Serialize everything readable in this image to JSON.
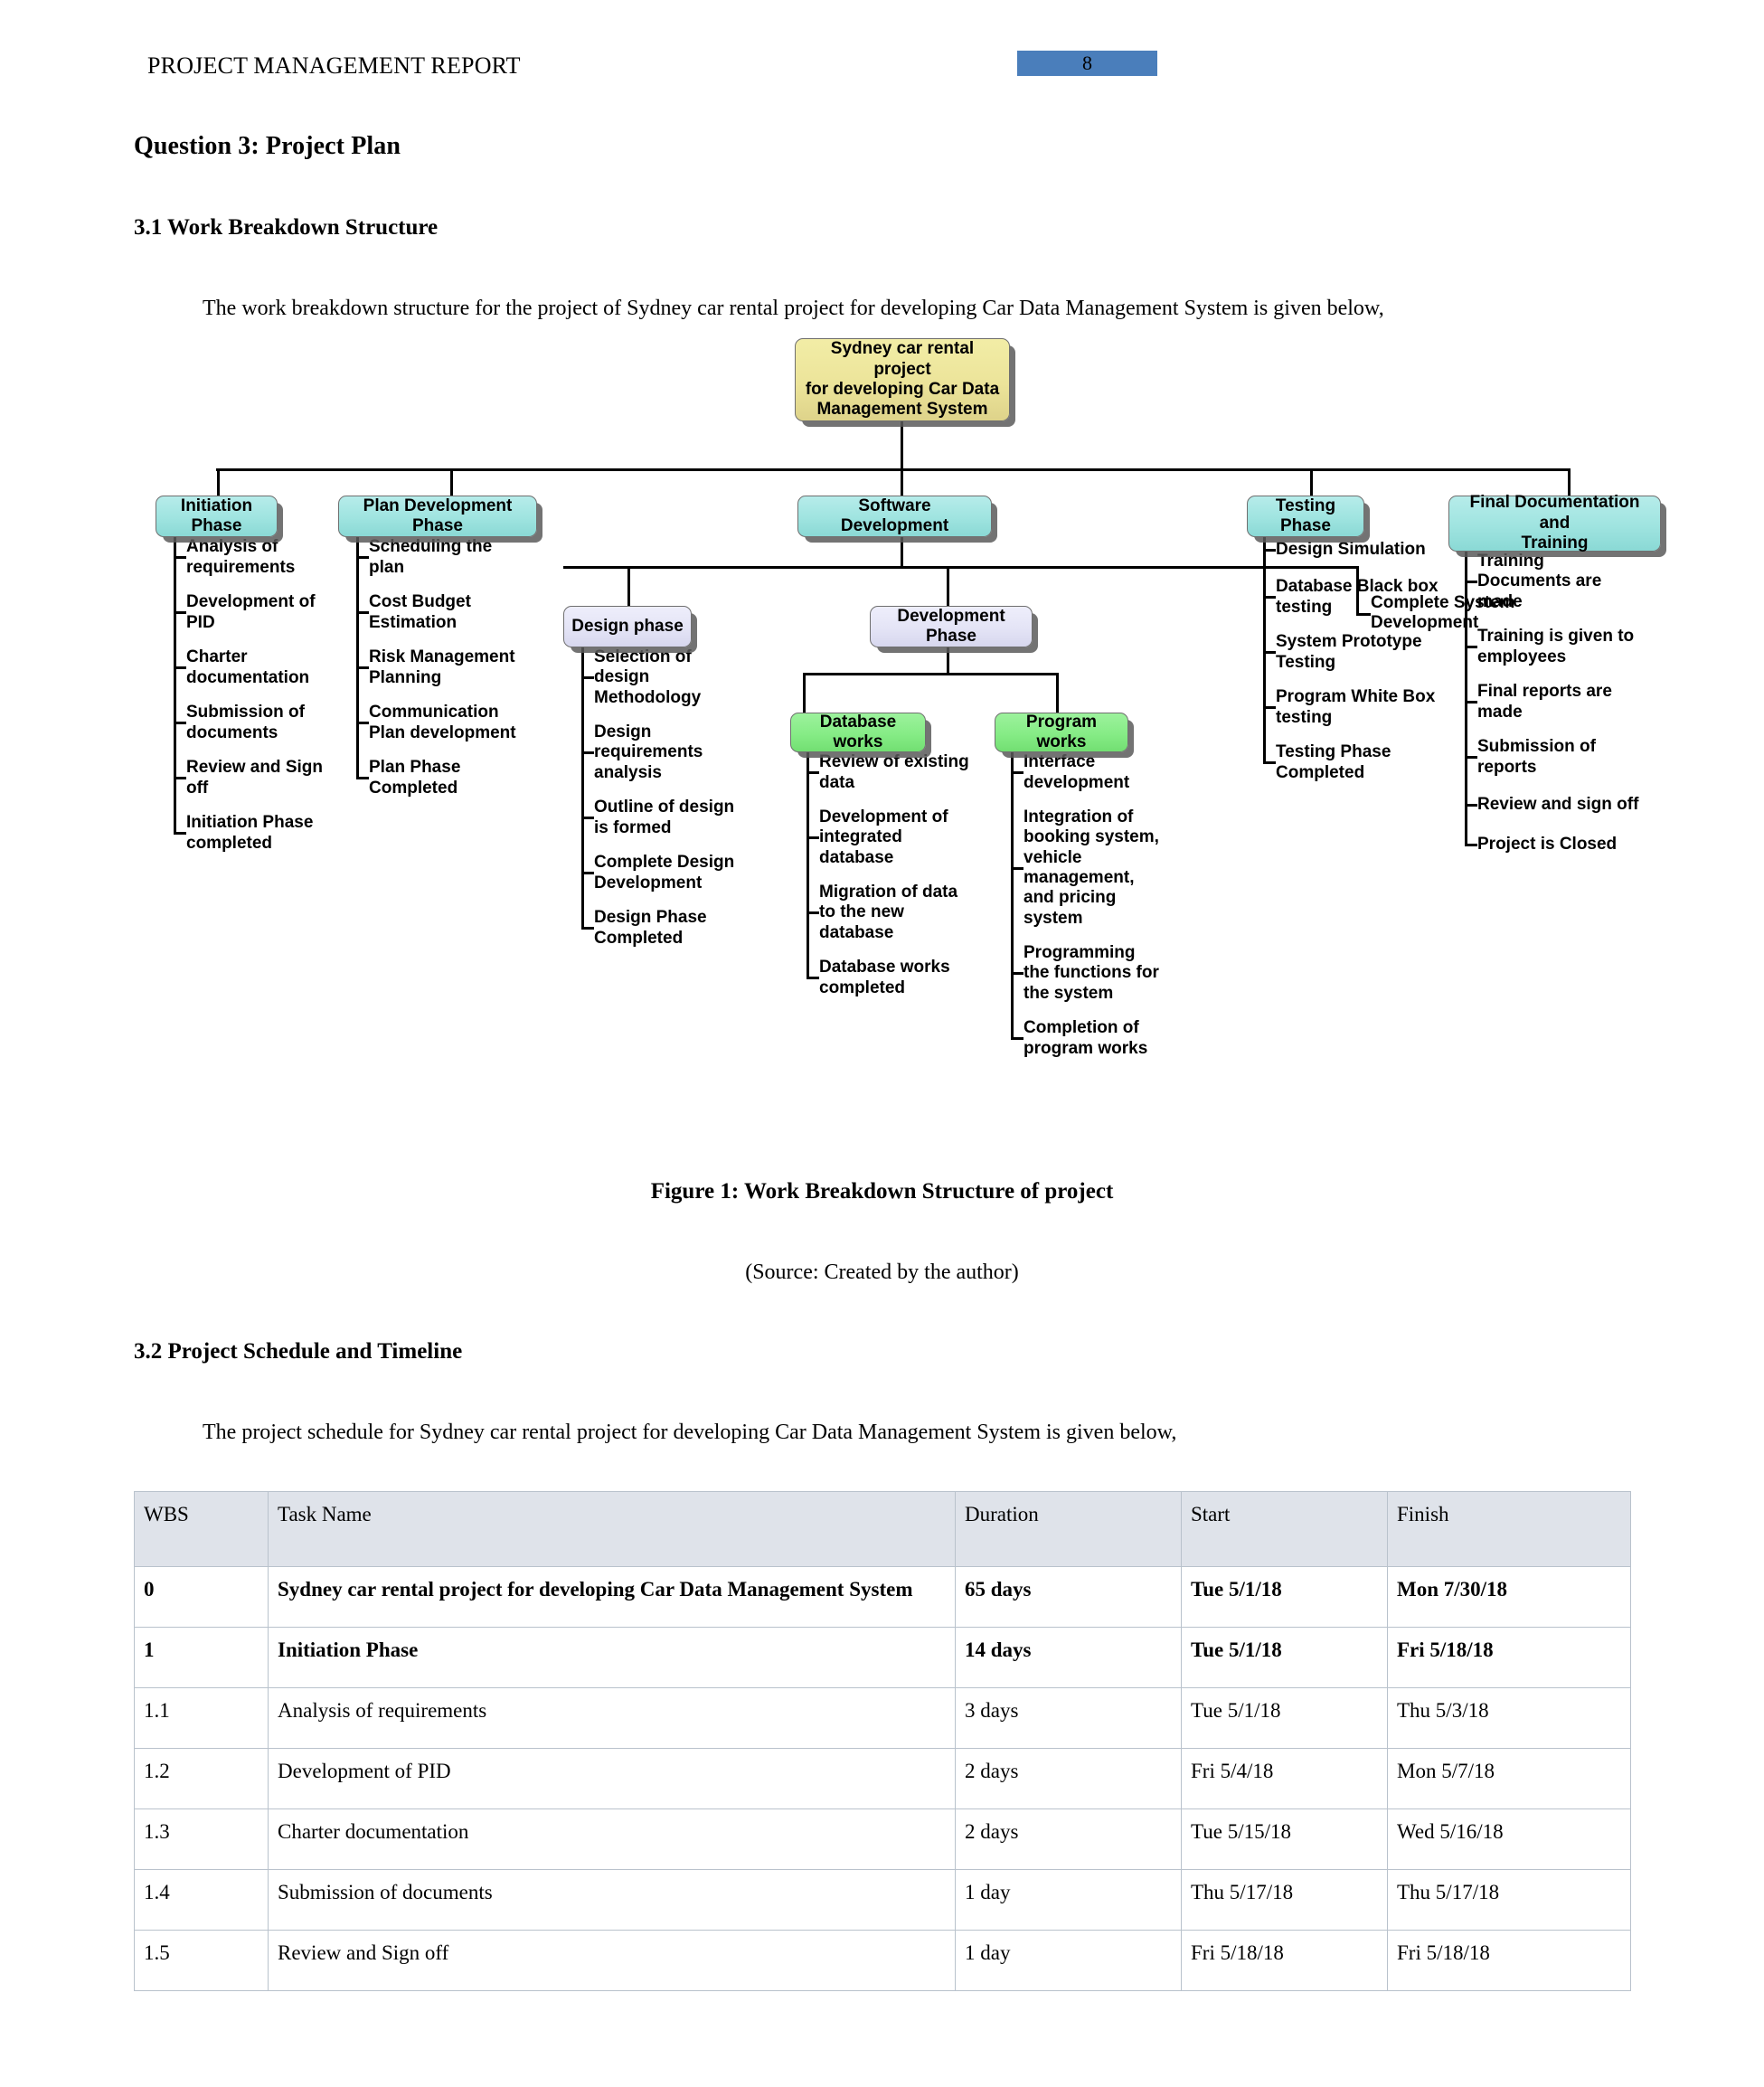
{
  "header": {
    "title": "PROJECT MANAGEMENT REPORT",
    "page_number": "8",
    "page_number_color": "#4a7ebb"
  },
  "headings": {
    "question": "Question 3: Project Plan",
    "section_3_1": "3.1 Work Breakdown Structure",
    "section_3_2": "3.2 Project Schedule and Timeline"
  },
  "paragraphs": {
    "wbs_intro": "The work breakdown structure for the project of Sydney car rental project for developing Car Data Management System is given below,",
    "schedule_intro": "The project schedule for Sydney car rental project for developing Car Data Management System is given below,"
  },
  "figure": {
    "caption": "Figure 1: Work Breakdown Structure of project",
    "source": "(Source: Created by the author)"
  },
  "wbs": {
    "colors": {
      "root": "#ece49a",
      "phase": "#9fe4e0",
      "sub": "#e4e4f6",
      "work": "#86ec86"
    },
    "root": "Sydney car rental project for developing Car Data Management System",
    "root_lines": [
      "Sydney car rental project",
      "for developing Car Data",
      "Management System"
    ],
    "phases": [
      {
        "label": "Initiation Phase",
        "leaves": [
          "Analysis of requirements",
          "Development of PID",
          "Charter documentation",
          "Submission of documents",
          "Review and Sign off",
          "Initiation Phase completed"
        ]
      },
      {
        "label": "Plan Development Phase",
        "leaves": [
          "Scheduling the plan",
          "Cost Budget Estimation",
          "Risk Management Planning",
          "Communication Plan development",
          "Plan Phase Completed"
        ]
      },
      {
        "label": "Software Development",
        "leaves": [],
        "children": [
          {
            "label": "Design phase",
            "leaves": [
              "Selection of design Methodology",
              "Design requirements analysis",
              "Outline of design is formed",
              "Complete Design Development",
              "Design Phase Completed"
            ]
          },
          {
            "label": "Development Phase",
            "leaves": [],
            "children": [
              {
                "label": "Database works",
                "leaves": [
                  "Review of existing data",
                  "Development of integrated database",
                  "Migration of data to the new database",
                  "Database works completed"
                ]
              },
              {
                "label": "Program works",
                "leaves": [
                  "Interface development",
                  "Integration of booking system, vehicle management, and pricing system",
                  "Programming the functions for the system",
                  "Completion of program works"
                ]
              }
            ]
          }
        ],
        "text_leaf": "Complete System Development"
      },
      {
        "label": "Testing Phase",
        "leaves": [
          "Design Simulation",
          "Database Black box testing",
          "System Prototype Testing",
          "Program White Box testing",
          "Testing Phase Completed"
        ]
      },
      {
        "label": "Final Documentation and Training",
        "label_lines": [
          "Final Documentation and",
          "Training"
        ],
        "leaves": [
          "Training Documents are made",
          "Training is given to employees",
          "Final reports are made",
          "Submission of reports",
          "Review and sign off",
          "Project is Closed"
        ]
      }
    ]
  },
  "schedule_table": {
    "columns": [
      "WBS",
      "Task Name",
      "Duration",
      "Start",
      "Finish"
    ],
    "rows": [
      {
        "wbs": "0",
        "task": "Sydney car rental project for developing Car Data Management System",
        "duration": "65 days",
        "start": "Tue 5/1/18",
        "finish": "Mon 7/30/18",
        "bold": true,
        "indent": 0
      },
      {
        "wbs": "1",
        "task": "Initiation Phase",
        "duration": "14 days",
        "start": "Tue 5/1/18",
        "finish": "Fri 5/18/18",
        "bold": true,
        "indent": 1
      },
      {
        "wbs": "1.1",
        "task": "Analysis of requirements",
        "duration": "3 days",
        "start": "Tue 5/1/18",
        "finish": "Thu 5/3/18",
        "bold": false,
        "indent": 2
      },
      {
        "wbs": "1.2",
        "task": "Development of PID",
        "duration": "2 days",
        "start": "Fri 5/4/18",
        "finish": "Mon 5/7/18",
        "bold": false,
        "indent": 2
      },
      {
        "wbs": "1.3",
        "task": "Charter documentation",
        "duration": "2 days",
        "start": "Tue 5/15/18",
        "finish": "Wed 5/16/18",
        "bold": false,
        "indent": 2
      },
      {
        "wbs": "1.4",
        "task": "Submission of documents",
        "duration": "1 day",
        "start": "Thu 5/17/18",
        "finish": "Thu 5/17/18",
        "bold": false,
        "indent": 2
      },
      {
        "wbs": "1.5",
        "task": "Review and Sign off",
        "duration": "1 day",
        "start": "Fri 5/18/18",
        "finish": "Fri 5/18/18",
        "bold": false,
        "indent": 2
      }
    ]
  }
}
